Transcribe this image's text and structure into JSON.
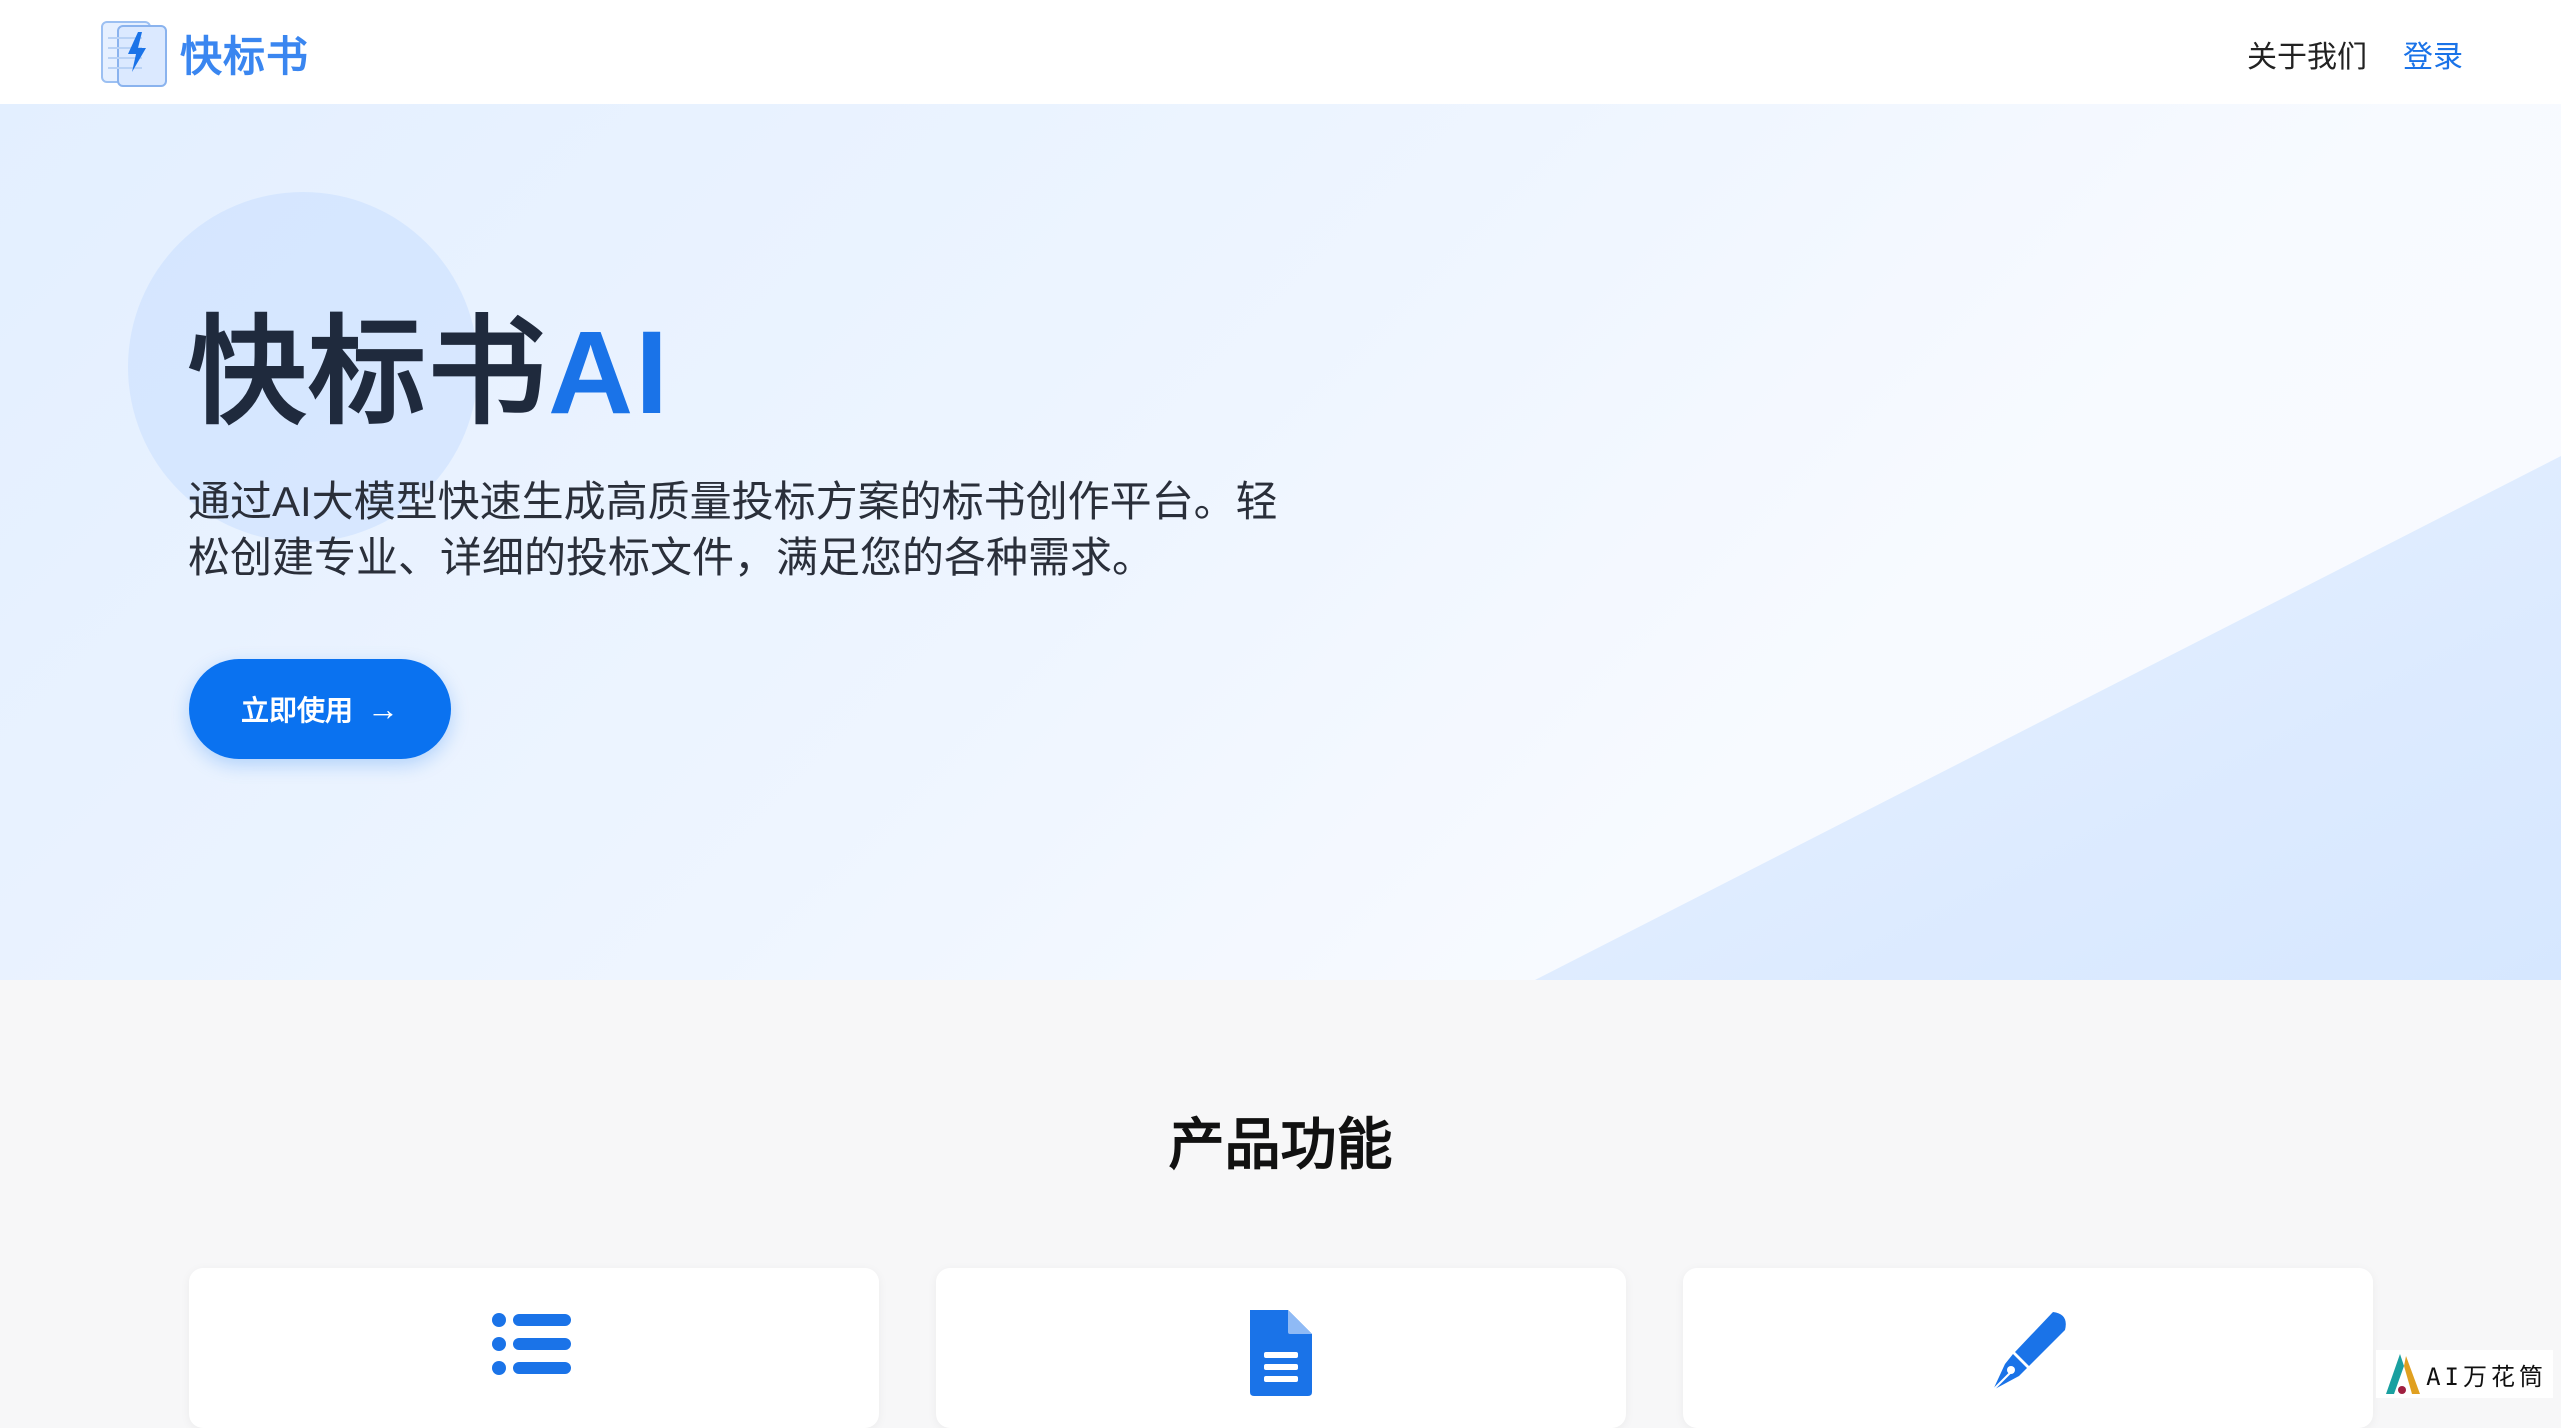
{
  "header": {
    "brand": "快标书",
    "nav": {
      "about": "关于我们",
      "login": "登录"
    }
  },
  "hero": {
    "title_main": "快标书",
    "title_accent": "AI",
    "description": "通过AI大模型快速生成高质量投标方案的标书创作平台。轻松创建专业、详细的投标文件，满足您的各种需求。",
    "cta_label": "立即使用",
    "cta_icon": "arrow-right-icon"
  },
  "features": {
    "title": "产品功能",
    "cards": [
      {
        "icon": "list-icon"
      },
      {
        "icon": "document-icon"
      },
      {
        "icon": "pen-icon"
      }
    ]
  },
  "watermark": {
    "text": "AI万花筒"
  },
  "colors": {
    "accent": "#1a73e8",
    "button": "#0a72f0",
    "brand_text": "#3a86f0",
    "title_dark": "#1f2a3d",
    "hero_bg": "#eef5ff"
  }
}
